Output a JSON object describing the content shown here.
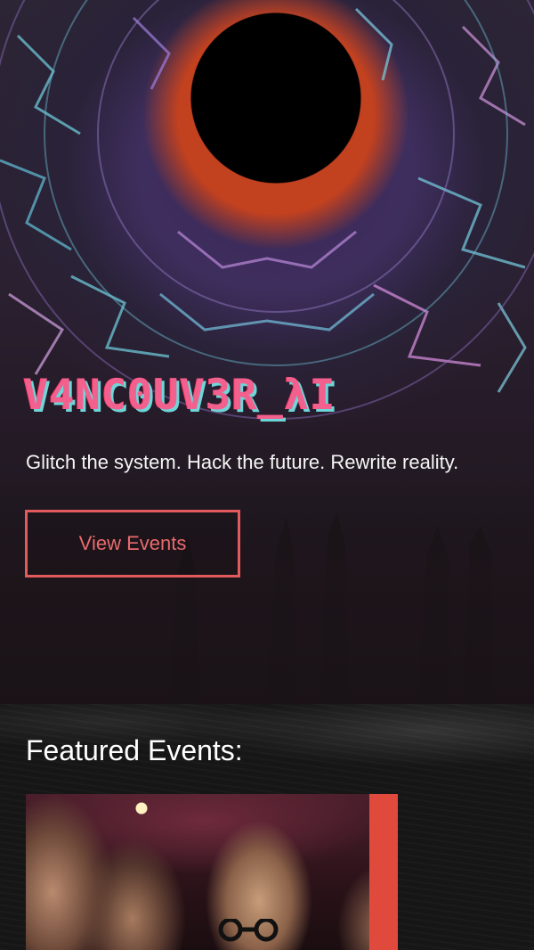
{
  "hero": {
    "title": "V4NC0UV3R_λI",
    "tagline": "Glitch the system. Hack the future. Rewrite reality.",
    "cta_label": "View Events"
  },
  "featured": {
    "heading": "Featured Events:",
    "events": [
      {
        "image": "event-crowd-photo"
      }
    ]
  },
  "colors": {
    "accent": "#e35a5c",
    "title_pink": "#f2608e",
    "title_cyan": "#6fd5d8",
    "page_background": "#141414"
  }
}
